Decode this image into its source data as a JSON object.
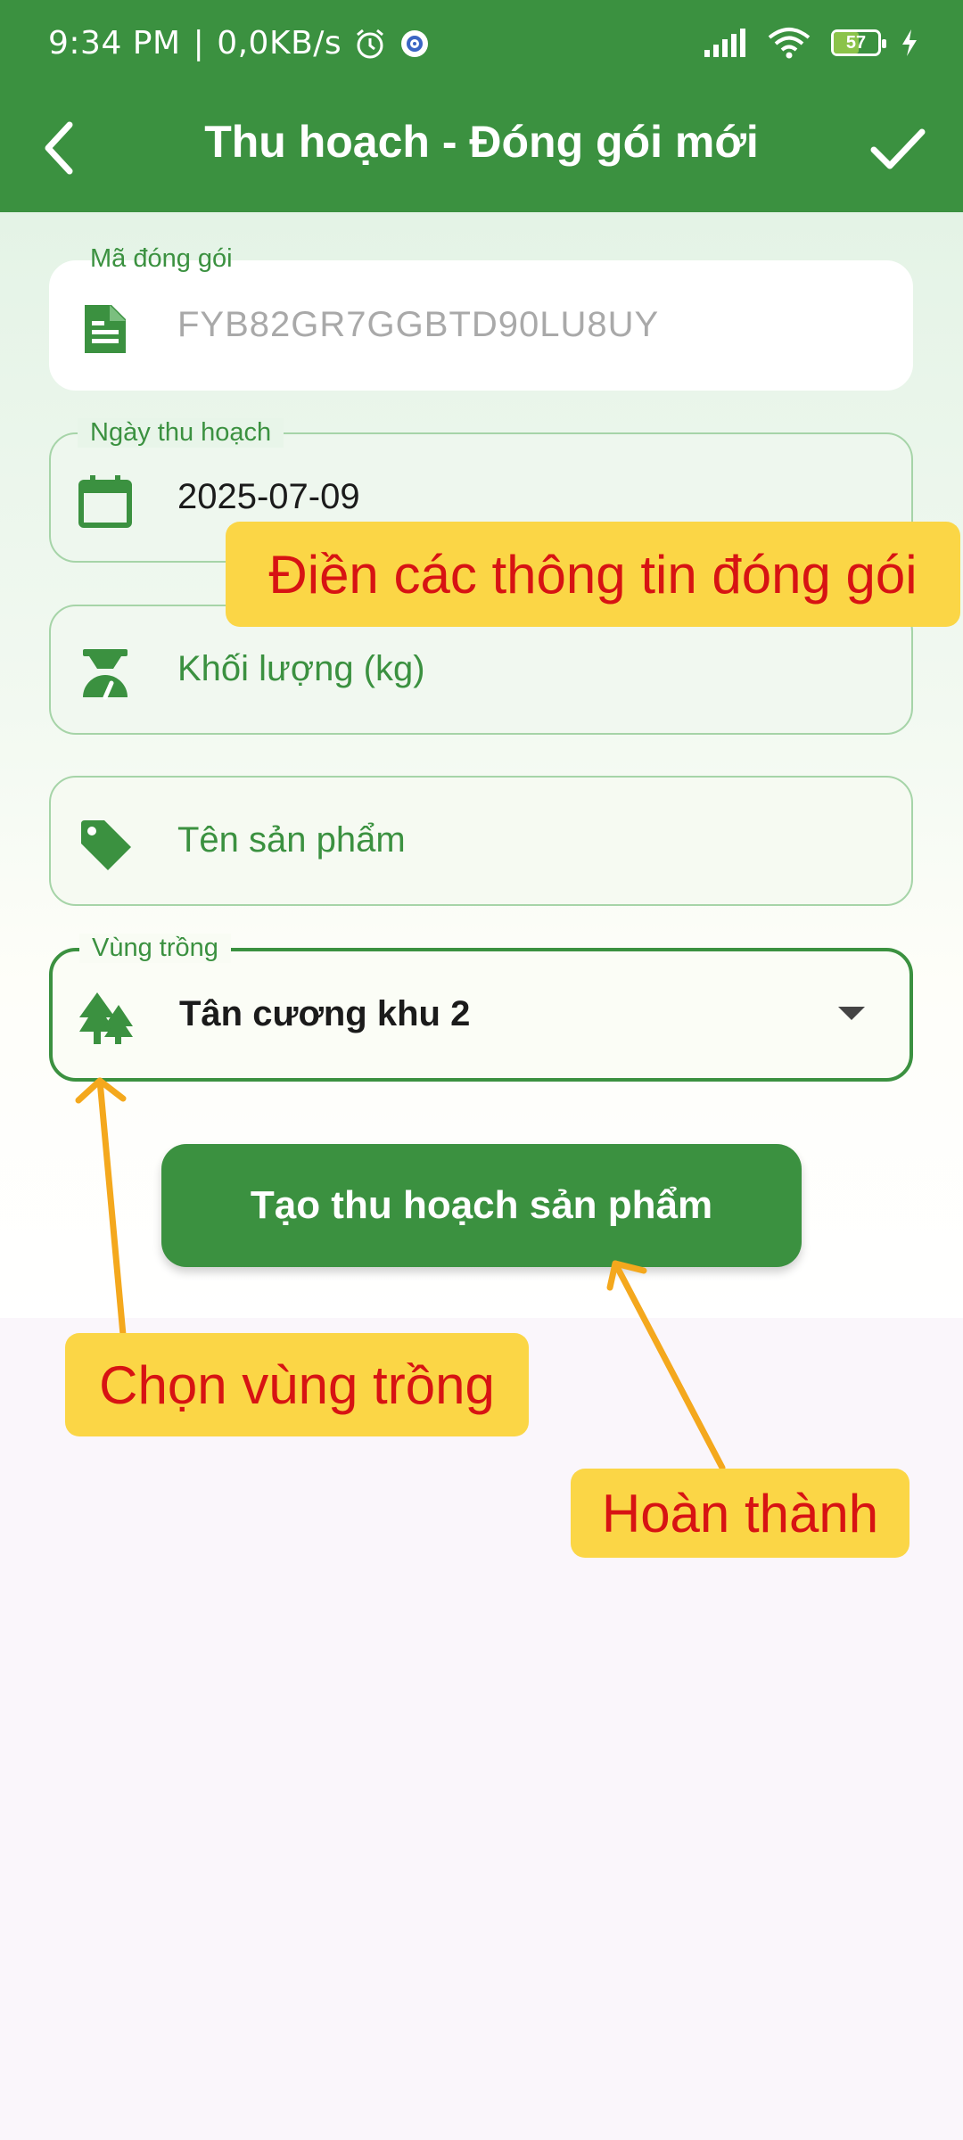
{
  "status_bar": {
    "time": "9:34 PM",
    "network_speed": "0,0KB/s",
    "battery": "57"
  },
  "app_bar": {
    "title": "Thu hoạch - Đóng gói mới"
  },
  "form": {
    "package_code": {
      "label": "Mã đóng gói",
      "value": "FYB82GR7GGBTD90LU8UY"
    },
    "harvest_date": {
      "label": "Ngày thu hoạch",
      "value": "2025-07-09"
    },
    "weight": {
      "placeholder": "Khối lượng (kg)"
    },
    "product_name": {
      "placeholder": "Tên sản phẩm"
    },
    "growing_area": {
      "label": "Vùng trồng",
      "value": "Tân cương khu 2"
    }
  },
  "submit_button": {
    "label": "Tạo thu hoạch sản phẩm"
  },
  "annotations": {
    "fill_info": "Điền các thông tin đóng gói",
    "choose_area": "Chọn vùng trồng",
    "done": "Hoàn thành"
  },
  "colors": {
    "primary": "#3b9140",
    "callout_bg": "#fbd646",
    "callout_text": "#d71313",
    "arrow": "#f4a81d"
  }
}
